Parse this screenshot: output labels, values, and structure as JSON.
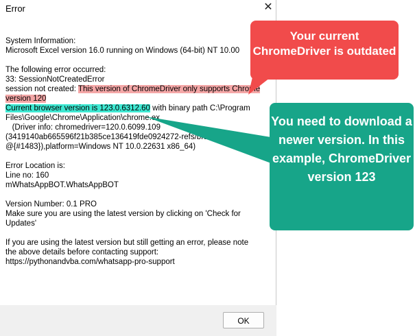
{
  "window": {
    "title": "Error",
    "close_glyph": "✕"
  },
  "message": {
    "lines": [
      "System Information:",
      "Microsoft Excel version 16.0 running on Windows (64-bit) NT 10.00",
      "",
      "The following error occurred:",
      "33: SessionNotCreatedError",
      "session not created: ",
      "This version of ChromeDriver only supports Chrome",
      "version 120",
      "Current browser version is 123.0.6312.60",
      " with binary path C:\\Program",
      "Files\\Google\\Chrome\\Application\\chrome.ex",
      "   (Driver info: chromedriver=120.0.6099.109",
      "(3419140ab665596f21b385ce136419fde0924272-refs/branc",
      "@{#1483}),platform=Windows NT 10.0.22631 x86_64)",
      "",
      "Error Location is:",
      "Line no: 160",
      "mWhatsAppBOT.WhatsAppBOT",
      "",
      "Version Number: 0.1 PRO",
      "Make sure you are using the latest version by clicking on 'Check for",
      "Updates'",
      "",
      "If you are using the latest version but still getting an error, please note",
      "the above details before contacting support:",
      "https://pythonandvba.com/whatsapp-pro-support"
    ]
  },
  "ok_label": "OK",
  "callouts": {
    "red": "Your current ChromeDriver is outdated",
    "green": "You need to download a newer version. In this example, ChromeDriver version 123"
  },
  "colors": {
    "red_callout": "#f14b4b",
    "green_callout": "#17a589",
    "red_highlight": "#f4a7a7",
    "cyan_highlight": "#3ee8d2"
  }
}
